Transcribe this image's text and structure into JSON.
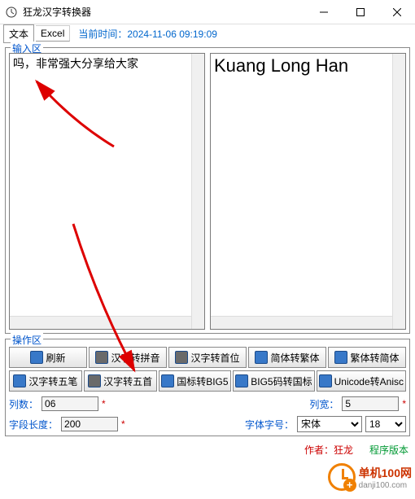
{
  "window": {
    "title": "狂龙汉字转换器"
  },
  "tabs": {
    "text": "文本",
    "excel": "Excel"
  },
  "time": {
    "label": "当前时间：",
    "value": "2024-11-06  09:19:09"
  },
  "input": {
    "label": "输入区",
    "left_text": "吗，非常强大分享给大家",
    "right_text": "Kuang  Long  Han"
  },
  "ops": {
    "label": "操作区",
    "row1": [
      "刷新",
      "汉字转拼音",
      "汉字转首位",
      "简体转繁体",
      "繁体转简体"
    ],
    "row2": [
      "汉字转五笔",
      "汉字转五首",
      "国标转BIG5",
      "BIG5码转国标",
      "Unicode转Anisc"
    ]
  },
  "fields": {
    "col_label": "列数：",
    "col_value": "06",
    "width_label": "列宽：",
    "width_value": "5",
    "len_label": "字段长度：",
    "len_value": "200",
    "font_label": "字体字号：",
    "font_name": "宋体",
    "font_size": "18"
  },
  "footer": {
    "author_label": "作者：",
    "author": "狂龙",
    "progress_label": "程序版本"
  },
  "watermark": {
    "brand": "单机100网",
    "url": "danji100.com"
  }
}
